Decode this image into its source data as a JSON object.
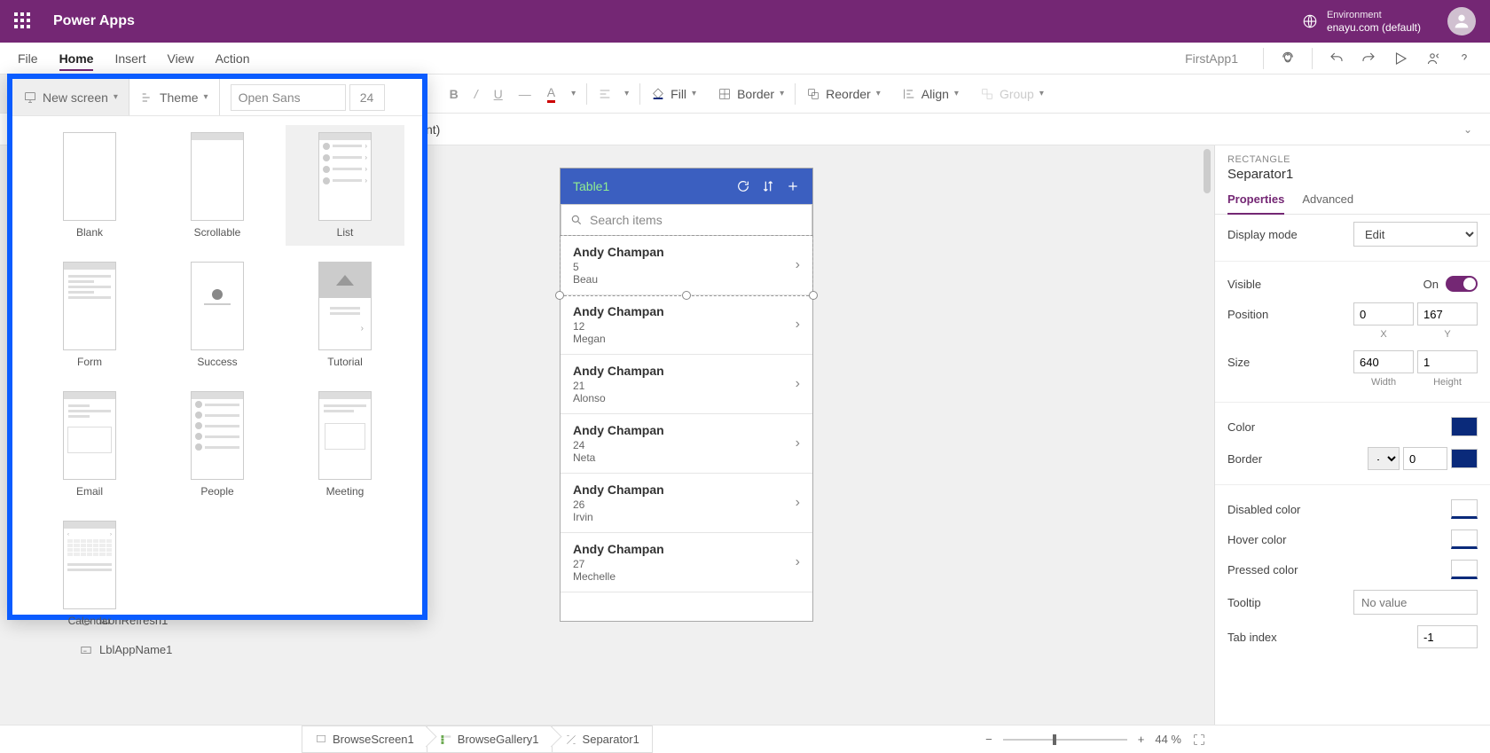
{
  "top": {
    "title": "Power Apps",
    "env_label": "Environment",
    "env_value": "enayu.com (default)"
  },
  "menu": {
    "items": [
      "File",
      "Home",
      "Insert",
      "View",
      "Action"
    ],
    "active": "Home",
    "appname": "FirstApp1"
  },
  "toolbar": {
    "new_screen": "New screen",
    "theme": "Theme",
    "font": "Open Sans",
    "font_size": "24",
    "fill": "Fill",
    "border": "Border",
    "reorder": "Reorder",
    "align": "Align",
    "group": "Group"
  },
  "formula": {
    "text": "nt)"
  },
  "dropdown": {
    "items": [
      "Blank",
      "Scrollable",
      "List",
      "Form",
      "Success",
      "Tutorial",
      "Email",
      "People",
      "Meeting",
      "Calendar"
    ],
    "selected": "List"
  },
  "phone": {
    "title": "Table1",
    "search_placeholder": "Search items",
    "rows": [
      {
        "name": "Andy Champan",
        "num": "5",
        "sub": "Beau"
      },
      {
        "name": "Andy Champan",
        "num": "12",
        "sub": "Megan"
      },
      {
        "name": "Andy Champan",
        "num": "21",
        "sub": "Alonso"
      },
      {
        "name": "Andy Champan",
        "num": "24",
        "sub": "Neta"
      },
      {
        "name": "Andy Champan",
        "num": "26",
        "sub": "Irvin"
      },
      {
        "name": "Andy Champan",
        "num": "27",
        "sub": "Mechelle"
      }
    ]
  },
  "rp": {
    "type": "RECTANGLE",
    "name": "Separator1",
    "tabs": [
      "Properties",
      "Advanced"
    ],
    "display_mode_lbl": "Display mode",
    "display_mode_val": "Edit",
    "visible_lbl": "Visible",
    "visible_val": "On",
    "position_lbl": "Position",
    "pos_x": "0",
    "pos_y": "167",
    "x_lbl": "X",
    "y_lbl": "Y",
    "size_lbl": "Size",
    "size_w": "640",
    "size_h": "1",
    "w_lbl": "Width",
    "h_lbl": "Height",
    "color_lbl": "Color",
    "border_lbl": "Border",
    "border_val": "0",
    "disabled_lbl": "Disabled color",
    "hover_lbl": "Hover color",
    "pressed_lbl": "Pressed color",
    "tooltip_lbl": "Tooltip",
    "tooltip_ph": "No value",
    "tab_index_lbl": "Tab index",
    "tab_index_val": "-1",
    "colors": {
      "main": "#0a2a7a",
      "border": "#0a2a7a"
    }
  },
  "breadcrumb": [
    "BrowseScreen1",
    "BrowseGallery1",
    "Separator1"
  ],
  "zoom": {
    "value": "44 %"
  },
  "tree_peek": [
    "IconRefresh1",
    "LblAppName1"
  ]
}
